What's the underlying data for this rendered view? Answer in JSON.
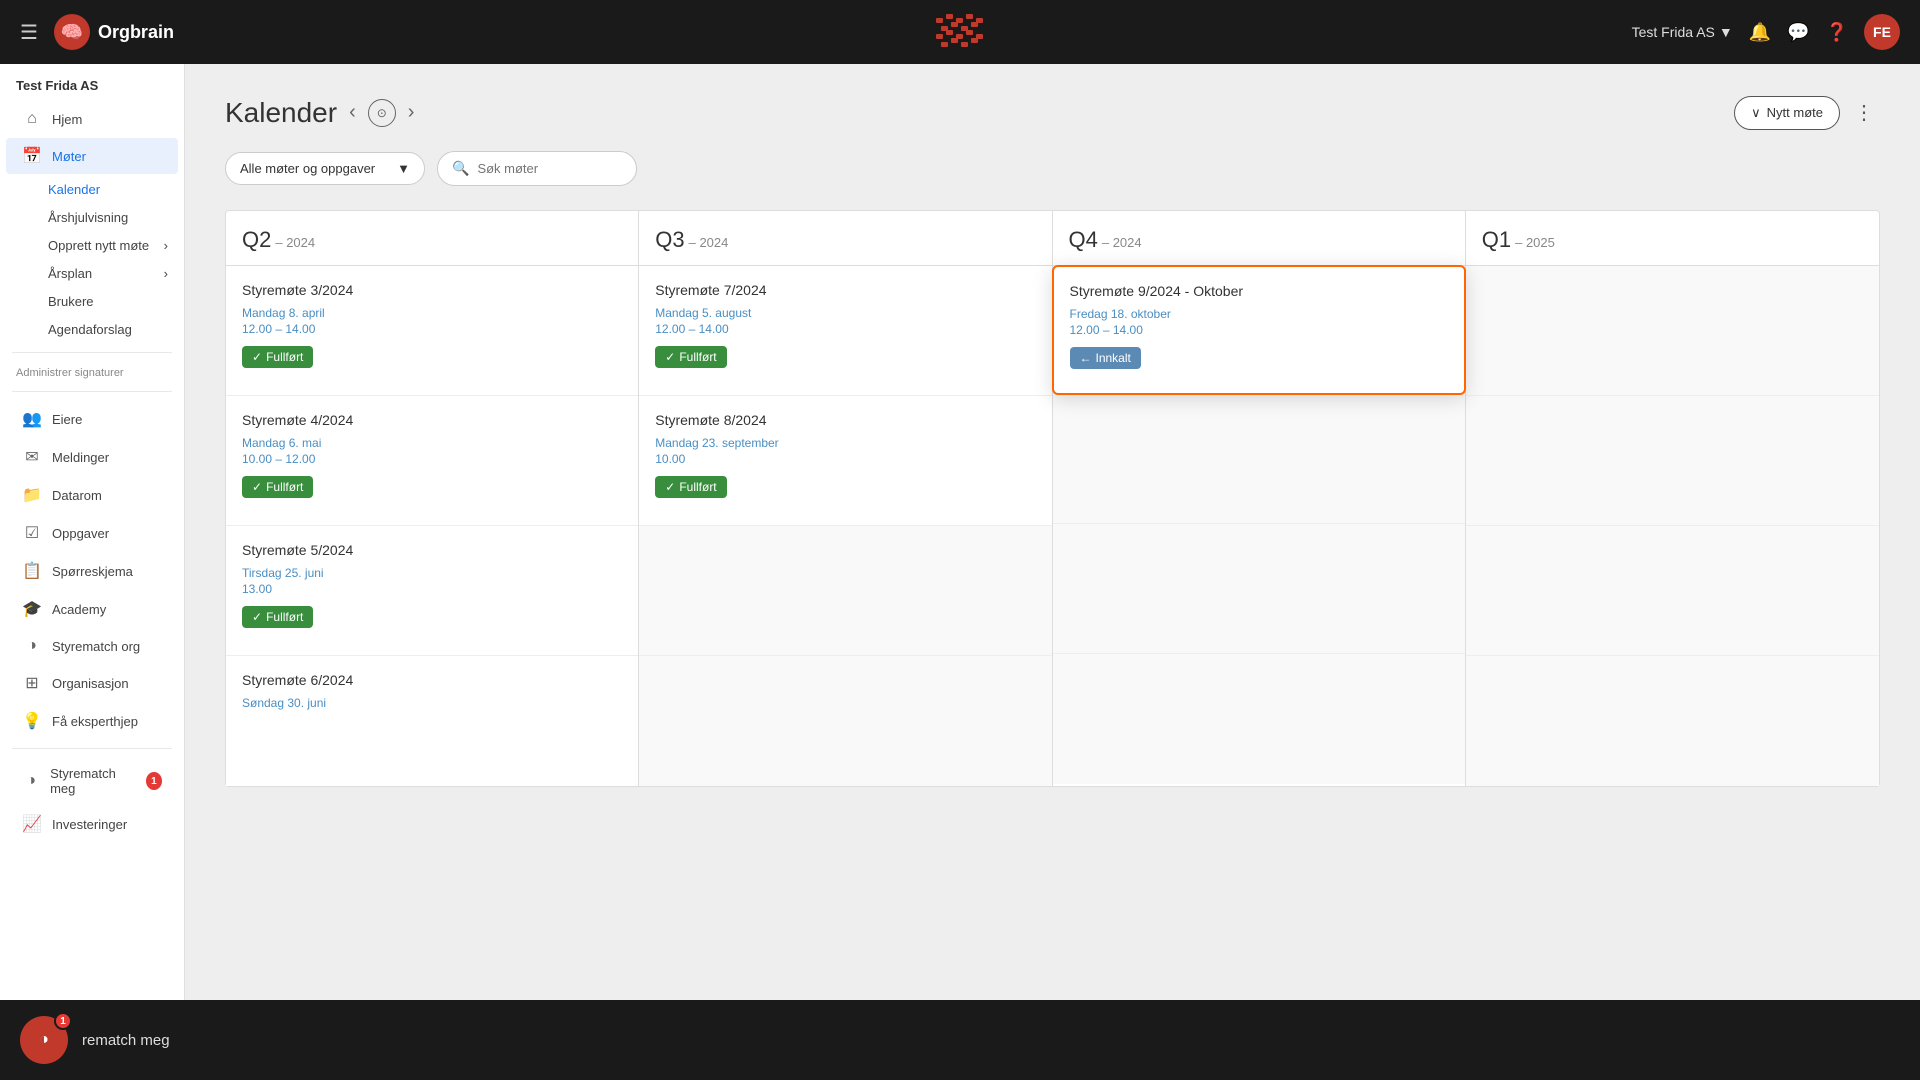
{
  "app": {
    "title": "Orgbrain",
    "company": "Test Frida AS",
    "company_dropdown": "Test Frida AS",
    "user_initials": "FE"
  },
  "topbar": {
    "company_label": "Test Frida AS",
    "notifications_icon": "bell-icon",
    "messages_icon": "chat-icon",
    "help_icon": "help-icon",
    "user_initials": "FE"
  },
  "sidebar": {
    "company_name": "Test Frida AS",
    "items": [
      {
        "id": "hjem",
        "label": "Hjem",
        "icon": "home"
      },
      {
        "id": "moter",
        "label": "Møter",
        "icon": "calendar",
        "active": true
      },
      {
        "id": "eiere",
        "label": "Eiere",
        "icon": "people"
      },
      {
        "id": "meldinger",
        "label": "Meldinger",
        "icon": "message"
      },
      {
        "id": "datarom",
        "label": "Datarom",
        "icon": "folder"
      },
      {
        "id": "oppgaver",
        "label": "Oppgaver",
        "icon": "tasks"
      },
      {
        "id": "sporreskjema",
        "label": "Spørreskjema",
        "icon": "survey"
      },
      {
        "id": "academy",
        "label": "Academy",
        "icon": "academy"
      },
      {
        "id": "styrematch-org",
        "label": "Styrematch org",
        "icon": "styrematch"
      },
      {
        "id": "organisasjon",
        "label": "Organisasjon",
        "icon": "org"
      },
      {
        "id": "fa-eksperthjep",
        "label": "Få eksperthjep",
        "icon": "expert"
      }
    ],
    "sub_items": [
      {
        "id": "kalender",
        "label": "Kalender",
        "active": true
      },
      {
        "id": "arshjulvisning",
        "label": "Årshjulvisning"
      },
      {
        "id": "opprett-nytt-mote",
        "label": "Opprett nytt møte",
        "has_arrow": true
      },
      {
        "id": "arsplan",
        "label": "Årsplan",
        "has_arrow": true
      },
      {
        "id": "brukere",
        "label": "Brukere"
      },
      {
        "id": "agendaforslag",
        "label": "Agendaforslag"
      }
    ],
    "manage_signatures": "Administrer signaturer",
    "bottom_items": [
      {
        "id": "styrematch-meg",
        "label": "Styrematch meg",
        "badge": "1"
      },
      {
        "id": "investeringer",
        "label": "Investeringer"
      }
    ]
  },
  "calendar": {
    "title": "Kalender",
    "filter_label": "Alle møter og oppgaver",
    "search_placeholder": "Søk møter",
    "new_meeting_label": "Nytt møte",
    "quarters": [
      {
        "id": "q2",
        "label": "Q2",
        "year": "2024",
        "meetings": [
          {
            "id": "styremote-3",
            "title": "Styremøte 3/2024",
            "date": "Mandag 8. april",
            "time": "12.00 – 14.00",
            "status": "Fullført",
            "status_type": "fullfort"
          },
          {
            "id": "styremote-4",
            "title": "Styremøte 4/2024",
            "date": "Mandag 6. mai",
            "time": "10.00 – 12.00",
            "status": "Fullført",
            "status_type": "fullfort"
          },
          {
            "id": "styremote-5",
            "title": "Styremøte 5/2024",
            "date": "Tirsdag 25. juni",
            "time": "13.00",
            "status": "Fullført",
            "status_type": "fullfort"
          },
          {
            "id": "styremote-6",
            "title": "Styremøte 6/2024",
            "date": "Søndag 30. juni",
            "time": "",
            "status": "",
            "status_type": ""
          }
        ]
      },
      {
        "id": "q3",
        "label": "Q3",
        "year": "2024",
        "meetings": [
          {
            "id": "styremote-7",
            "title": "Styremøte 7/2024",
            "date": "Mandag 5. august",
            "time": "12.00 – 14.00",
            "status": "Fullført",
            "status_type": "fullfort"
          },
          {
            "id": "styremote-8",
            "title": "Styremøte 8/2024",
            "date": "Mandag 23. september",
            "time": "10.00",
            "status": "Fullført",
            "status_type": "fullfort"
          }
        ]
      },
      {
        "id": "q4",
        "label": "Q4",
        "year": "2024",
        "meetings": [
          {
            "id": "styremote-9",
            "title": "Styremøte 9/2024 - Oktober",
            "date": "Fredag 18. oktober",
            "time": "12.00 – 14.00",
            "status": "Innkalt",
            "status_type": "innkalt",
            "highlighted": true
          }
        ]
      },
      {
        "id": "q1-2025",
        "label": "Q1",
        "year": "2025",
        "meetings": []
      }
    ]
  },
  "bottombar": {
    "text": "rematch meg",
    "badge": "1"
  }
}
